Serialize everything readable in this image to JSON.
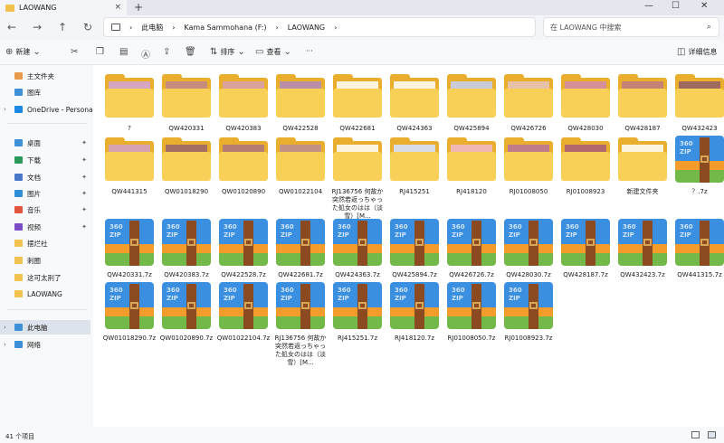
{
  "tab": {
    "title": "LAOWANG",
    "close": "×",
    "new": "+"
  },
  "window": {
    "minimize": "—",
    "maximize": "☐",
    "close": "✕"
  },
  "nav": {
    "back": "←",
    "forward": "→",
    "up": "↑",
    "refresh": "↻"
  },
  "breadcrumb": [
    "此电脑",
    "Kama Sammohana (F:)",
    "LAOWANG"
  ],
  "search": {
    "placeholder": "在 LAOWANG 中搜索"
  },
  "toolbar": {
    "new": "新建",
    "sort": "排序",
    "view": "查看",
    "more": "···",
    "details": "详细信息"
  },
  "sidebar": {
    "items": [
      {
        "label": "主文件夹",
        "icon": "home-icon"
      },
      {
        "label": "图库",
        "icon": "gallery-icon"
      },
      {
        "label": "OneDrive - Personal",
        "icon": "cloud-icon"
      },
      {
        "label": "桌面",
        "icon": "desktop-icon",
        "pinned": true
      },
      {
        "label": "下载",
        "icon": "download-icon",
        "pinned": true
      },
      {
        "label": "文档",
        "icon": "document-icon",
        "pinned": true
      },
      {
        "label": "图片",
        "icon": "pictures-icon",
        "pinned": true
      },
      {
        "label": "音乐",
        "icon": "music-icon",
        "pinned": true
      },
      {
        "label": "视频",
        "icon": "video-icon",
        "pinned": true
      },
      {
        "label": "摆烂社",
        "icon": "folder-icon"
      },
      {
        "label": "刺圈",
        "icon": "folder-icon"
      },
      {
        "label": "这可太刑了",
        "icon": "folder-icon"
      },
      {
        "label": "LAOWANG",
        "icon": "folder-icon"
      },
      {
        "label": "此电脑",
        "icon": "pc-icon"
      },
      {
        "label": "网络",
        "icon": "network-icon"
      }
    ]
  },
  "files": [
    {
      "name": "?",
      "type": "folder",
      "pic": "#d7a6c0"
    },
    {
      "name": "QW420331",
      "type": "folder",
      "pic": "#c58c7e"
    },
    {
      "name": "QW420383",
      "type": "folder",
      "pic": "#d9a19b"
    },
    {
      "name": "QW422528",
      "type": "folder",
      "pic": "#b98fa6"
    },
    {
      "name": "QW422681",
      "type": "folder",
      "pic": ""
    },
    {
      "name": "QW424363",
      "type": "folder",
      "pic": ""
    },
    {
      "name": "QW425894",
      "type": "folder",
      "pic": "#c9ccd6"
    },
    {
      "name": "QW426726",
      "type": "folder",
      "pic": "#e7c2a9"
    },
    {
      "name": "QW428030",
      "type": "folder",
      "pic": "#d58f97"
    },
    {
      "name": "QW428187",
      "type": "folder",
      "pic": "#c38274"
    },
    {
      "name": "QW432423",
      "type": "folder",
      "pic": "#9e6a5d"
    },
    {
      "name": "QW441315",
      "type": "folder",
      "pic": "#d8a3b0"
    },
    {
      "name": "QW01018290",
      "type": "folder",
      "pic": "#a56e62"
    },
    {
      "name": "QW01020890",
      "type": "folder",
      "pic": "#b87d72"
    },
    {
      "name": "QW01022104",
      "type": "folder",
      "pic": "#c39184"
    },
    {
      "name": "RJ136756 何故か突然若返っちゃった処女のはは（淡雪）[M...",
      "type": "folder",
      "pic": ""
    },
    {
      "name": "RJ415251",
      "type": "folder",
      "pic": "#d8dce6"
    },
    {
      "name": "RJ418120",
      "type": "folder",
      "pic": "#f0b7b2"
    },
    {
      "name": "RJ01008050",
      "type": "folder",
      "pic": "#c17c89"
    },
    {
      "name": "RJ01008923",
      "type": "folder",
      "pic": "#b1676c"
    },
    {
      "name": "新建文件夹",
      "type": "folder",
      "pic": ""
    },
    {
      "name": "？.7z",
      "type": "zip"
    },
    {
      "name": "QW420331.7z",
      "type": "zip"
    },
    {
      "name": "QW420383.7z",
      "type": "zip"
    },
    {
      "name": "QW422528.7z",
      "type": "zip"
    },
    {
      "name": "QW422681.7z",
      "type": "zip"
    },
    {
      "name": "QW424363.7z",
      "type": "zip"
    },
    {
      "name": "QW425894.7z",
      "type": "zip"
    },
    {
      "name": "QW426726.7z",
      "type": "zip"
    },
    {
      "name": "QW428030.7z",
      "type": "zip"
    },
    {
      "name": "QW428187.7z",
      "type": "zip"
    },
    {
      "name": "QW432423.7z",
      "type": "zip"
    },
    {
      "name": "QW441315.7z",
      "type": "zip"
    },
    {
      "name": "QW01018290.7z",
      "type": "zip"
    },
    {
      "name": "QW01020890.7z",
      "type": "zip"
    },
    {
      "name": "QW01022104.7z",
      "type": "zip"
    },
    {
      "name": "RJ136756 何故か突然若返っちゃった処女のはは（淡雪）[M...",
      "type": "zip"
    },
    {
      "name": "RJ415251.7z",
      "type": "zip"
    },
    {
      "name": "RJ418120.7z",
      "type": "zip"
    },
    {
      "name": "RJ01008050.7z",
      "type": "zip"
    },
    {
      "name": "RJ01008923.7z",
      "type": "zip"
    }
  ],
  "zip_text": [
    "360",
    "ZIP"
  ],
  "status": {
    "count": "41 个项目"
  }
}
